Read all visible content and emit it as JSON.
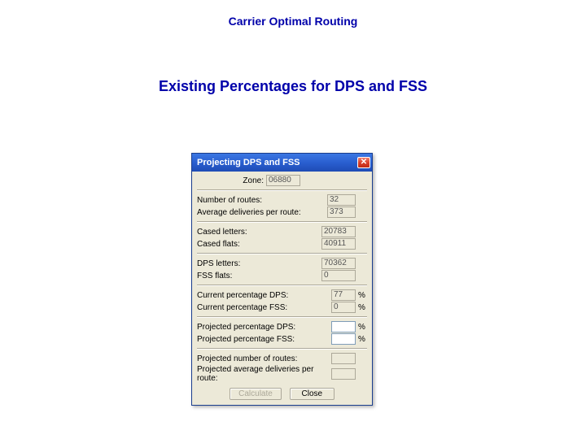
{
  "page": {
    "title": "Carrier Optimal Routing",
    "subtitle": "Existing Percentages for DPS and FSS"
  },
  "dialog": {
    "title": "Projecting DPS and FSS",
    "closeGlyph": "✕",
    "zoneLabel": "Zone:",
    "zoneValue": "06880",
    "numRoutesLabel": "Number of routes:",
    "numRoutesValue": "32",
    "avgDeliveriesLabel": "Average deliveries per route:",
    "avgDeliveriesValue": "373",
    "casedLettersLabel": "Cased letters:",
    "casedLettersValue": "20783",
    "casedFlatsLabel": "Cased flats:",
    "casedFlatsValue": "40911",
    "dpsLettersLabel": "DPS letters:",
    "dpsLettersValue": "70362",
    "fssFlatsLabel": "FSS flats:",
    "fssFlatsValue": "0",
    "curPctDpsLabel": "Current percentage DPS:",
    "curPctDpsValue": "77",
    "curPctFssLabel": "Current percentage FSS:",
    "curPctFssValue": "0",
    "projPctDpsLabel": "Projected percentage DPS:",
    "projPctDpsValue": "",
    "projPctFssLabel": "Projected percentage FSS:",
    "projPctFssValue": "",
    "projNumRoutesLabel": "Projected number of routes:",
    "projNumRoutesValue": "",
    "projAvgDelLabel": "Projected average deliveries per route:",
    "projAvgDelValue": "",
    "percentSuffix": "%",
    "calculateLabel": "Calculate",
    "closeLabel": "Close"
  }
}
